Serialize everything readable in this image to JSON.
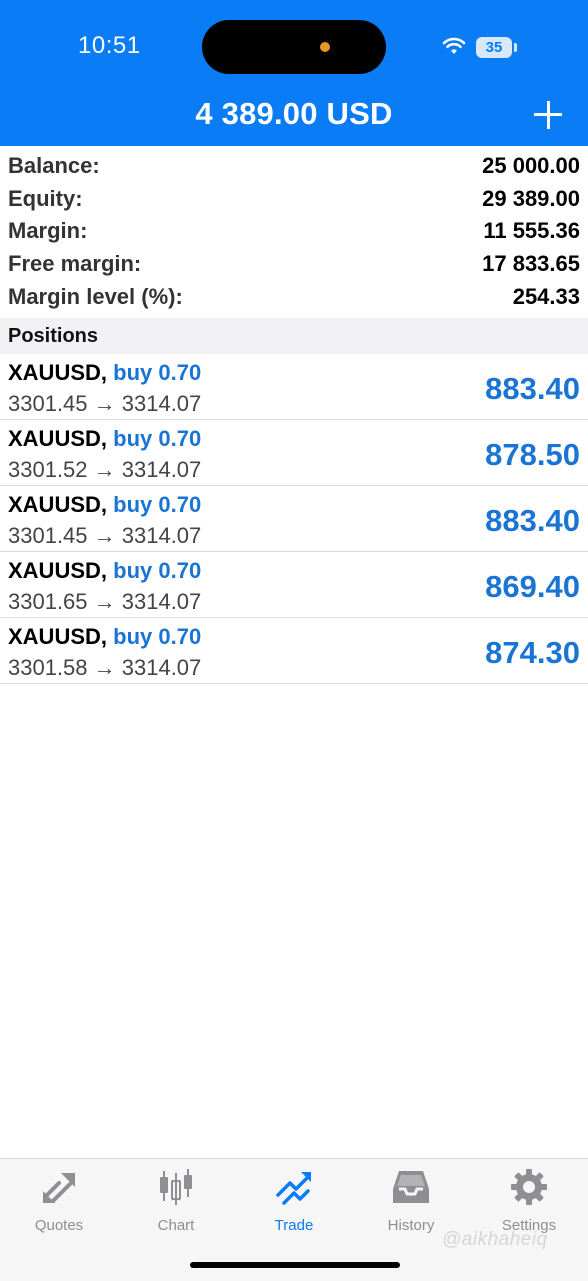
{
  "status_bar": {
    "time": "10:51",
    "battery": "35"
  },
  "header": {
    "title": "4 389.00 USD"
  },
  "summary": [
    {
      "label": "Balance:",
      "value": "25 000.00"
    },
    {
      "label": "Equity:",
      "value": "29 389.00"
    },
    {
      "label": "Margin:",
      "value": "11 555.36"
    },
    {
      "label": "Free margin:",
      "value": "17 833.65"
    },
    {
      "label": "Margin level (%):",
      "value": "254.33"
    }
  ],
  "positions_header": "Positions",
  "positions": [
    {
      "symbol": "XAUUSD,",
      "side": "buy 0.70",
      "prices": "3301.45 → 3314.07",
      "profit": "883.40"
    },
    {
      "symbol": "XAUUSD,",
      "side": "buy 0.70",
      "prices": "3301.52 → 3314.07",
      "profit": "878.50"
    },
    {
      "symbol": "XAUUSD,",
      "side": "buy 0.70",
      "prices": "3301.45 → 3314.07",
      "profit": "883.40"
    },
    {
      "symbol": "XAUUSD,",
      "side": "buy 0.70",
      "prices": "3301.65 → 3314.07",
      "profit": "869.40"
    },
    {
      "symbol": "XAUUSD,",
      "side": "buy 0.70",
      "prices": "3301.58 → 3314.07",
      "profit": "874.30"
    }
  ],
  "tabs": [
    {
      "label": "Quotes",
      "icon": "quotes-icon"
    },
    {
      "label": "Chart",
      "icon": "chart-icon"
    },
    {
      "label": "Trade",
      "icon": "trade-icon",
      "active": true
    },
    {
      "label": "History",
      "icon": "history-icon"
    },
    {
      "label": "Settings",
      "icon": "settings-icon"
    }
  ],
  "watermark": "@aikhaheiq",
  "colors": {
    "accent": "#0a7cf5",
    "profit": "#1a74d4",
    "inactive_tab": "#8e8e93"
  }
}
